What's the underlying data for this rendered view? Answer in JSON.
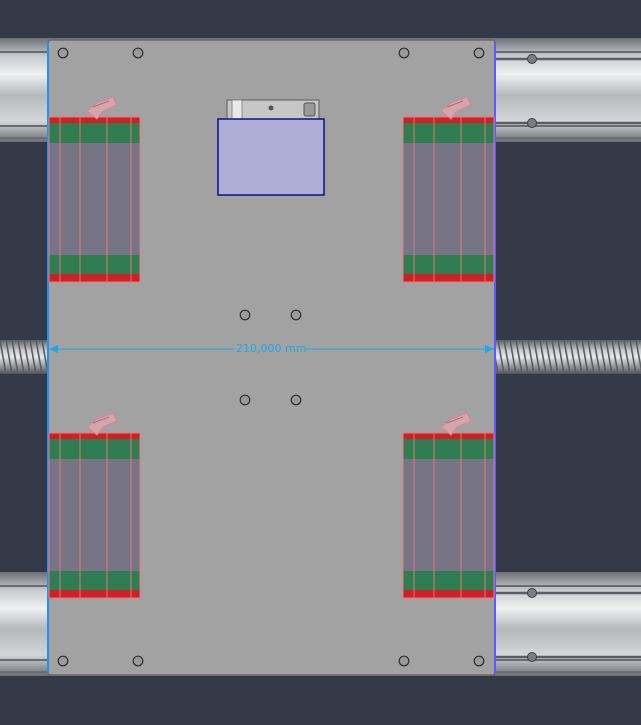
{
  "viewport": {
    "background_color": "#343948",
    "dimension": {
      "value_text": "210,000 mm",
      "color": "#18aaf0"
    }
  },
  "colors": {
    "plate": "#a2a2a2",
    "plate_edge": "#6a6a6a",
    "rail_metal": "#b8bcbf",
    "carriage_body": "#777486",
    "carriage_seal_green": "#2f7d50",
    "carriage_seal_red": "#cc2226",
    "carriage_outline": "#f07878",
    "selected_block": "#aeaed6",
    "selected_block_edge": "#101080",
    "plate_left_edge_highlight": "#1e90ff",
    "plate_right_edge_highlight": "#5a5aff"
  }
}
